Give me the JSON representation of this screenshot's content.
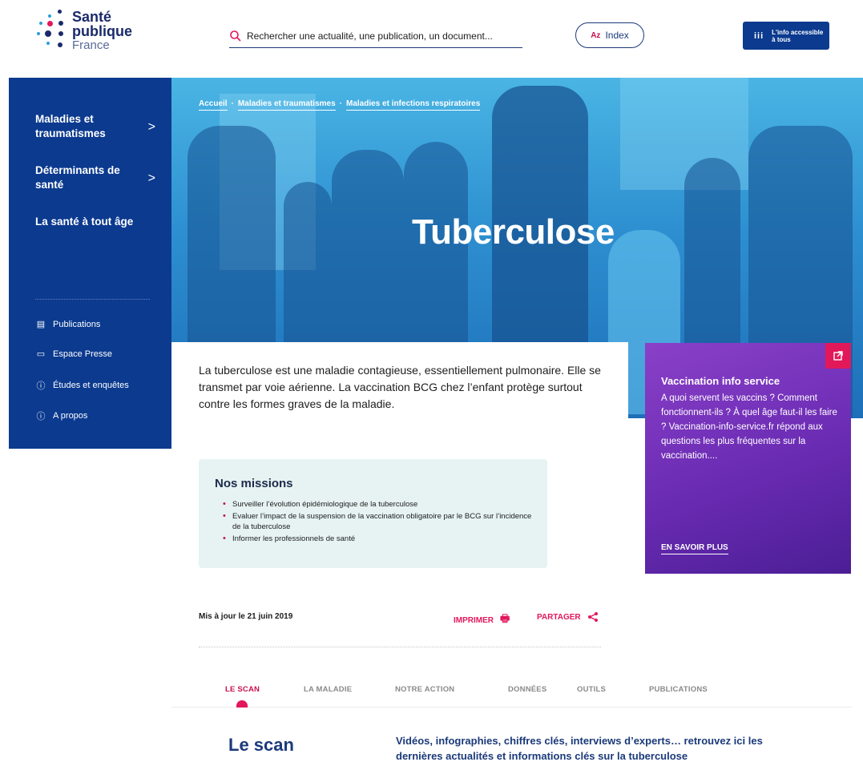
{
  "brand": {
    "logo_line1": "Santé",
    "logo_line2": "publique",
    "logo_line3": "France",
    "accent": "#e2185b",
    "primary": "#0b3a8f"
  },
  "header": {
    "search_placeholder": "Rechercher une actualité, une publication, un document...",
    "index_prefix": "Az",
    "index_label": "Index",
    "access_icon": "iii",
    "access_label_1": "L'info accessible",
    "access_label_2": "à tous"
  },
  "sidebar": {
    "nav": [
      {
        "label_1": "Maladies et",
        "label_2": "traumatismes",
        "chevron": ">"
      },
      {
        "label_1": "Déterminants de",
        "label_2": "santé",
        "chevron": ">"
      },
      {
        "label_1": "La santé à tout âge",
        "label_2": ""
      }
    ],
    "links": [
      {
        "label": "Publications",
        "icon": "book-icon"
      },
      {
        "label": "Espace Presse",
        "icon": "folder-icon"
      },
      {
        "label": "Études et enquêtes",
        "icon": "info-icon"
      },
      {
        "label": "A propos",
        "icon": "info-icon"
      }
    ]
  },
  "breadcrumb": {
    "items": [
      "Accueil",
      "Maladies et traumatismes",
      "Maladies et infections respiratoires"
    ],
    "separator": "·"
  },
  "hero": {
    "title": "Tuberculose"
  },
  "intro": {
    "text": "La tuberculose est une maladie contagieuse, essentiellement pulmonaire. Elle se transmet par voie aérienne. La vaccination BCG chez l’enfant protège surtout contre les formes graves de la maladie."
  },
  "promo": {
    "title": "Vaccination info service",
    "text": "A quoi servent les vaccins ? Comment fonctionnent-ils ? À quel âge faut-il les faire ? Vaccination-info-service.fr répond aux questions les plus fréquentes sur la vaccination....",
    "link": "EN SAVOIR PLUS"
  },
  "missions": {
    "title": "Nos missions",
    "items": [
      "Surveiller l’évolution épidémiologique de la tuberculose",
      "Evaluer l’impact de la suspension de la vaccination obligatoire par le BCG sur l’incidence de la tuberculose",
      "Informer les professionnels de santé"
    ]
  },
  "meta": {
    "updated": "Mis à jour le 21 juin 2019",
    "print_label": "IMPRIMER",
    "share_label": "PARTAGER"
  },
  "tabs": [
    "LE SCAN",
    "LA MALADIE",
    "NOTRE ACTION",
    "DONNÉES",
    "OUTILS",
    "PUBLICATIONS"
  ],
  "scan": {
    "title": "Le scan",
    "description": "Vidéos, infographies, chiffres clés, interviews d’experts… retrouvez ici les dernières actualités et informations clés sur la tuberculose"
  }
}
